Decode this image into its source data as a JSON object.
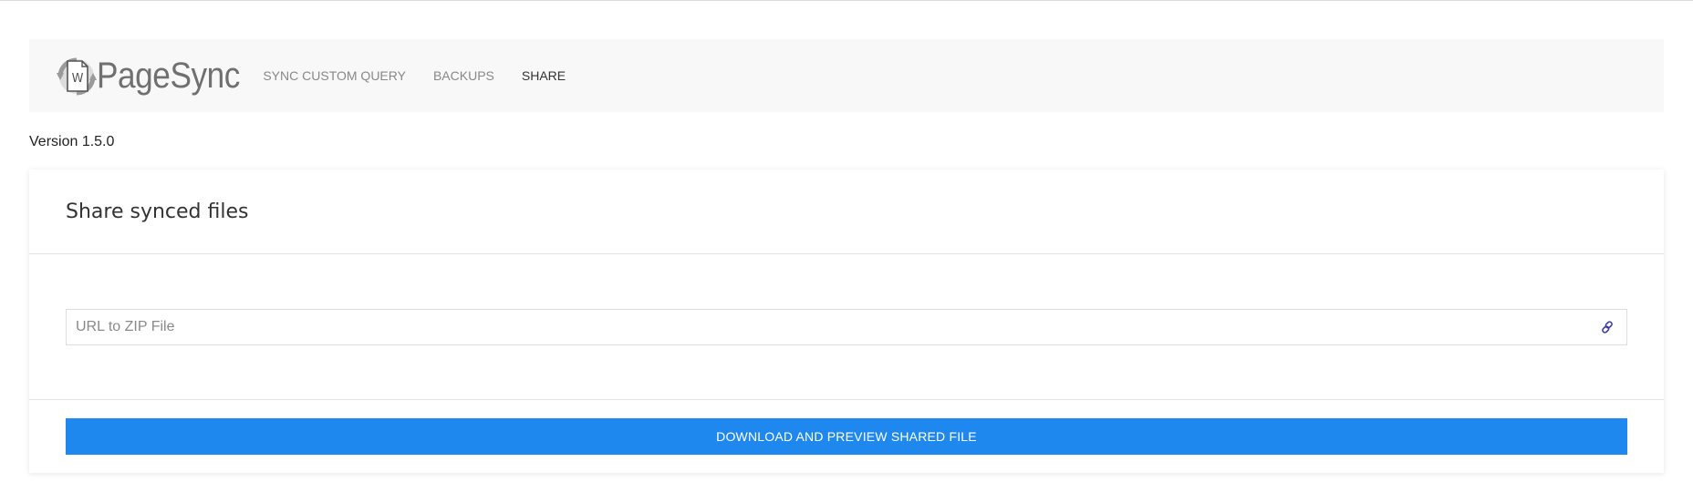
{
  "brand": {
    "name": "PageSync",
    "logo_letter": "W",
    "logo_icon": "sync-document-icon"
  },
  "nav": {
    "items": [
      {
        "label": "SYNC CUSTOM QUERY",
        "active": false
      },
      {
        "label": "BACKUPS",
        "active": false
      },
      {
        "label": "SHARE",
        "active": true
      }
    ]
  },
  "version": "Version 1.5.0",
  "card": {
    "title": "Share synced files",
    "url_input": {
      "value": "",
      "placeholder": "URL to ZIP File",
      "icon": "link-icon"
    },
    "primary_button_label": "DOWNLOAD AND PREVIEW SHARED FILE"
  },
  "colors": {
    "navbar_bg": "#f8f8f8",
    "primary": "#1e88ee",
    "link_icon": "#3a3aa0",
    "brand_text": "#707070"
  }
}
